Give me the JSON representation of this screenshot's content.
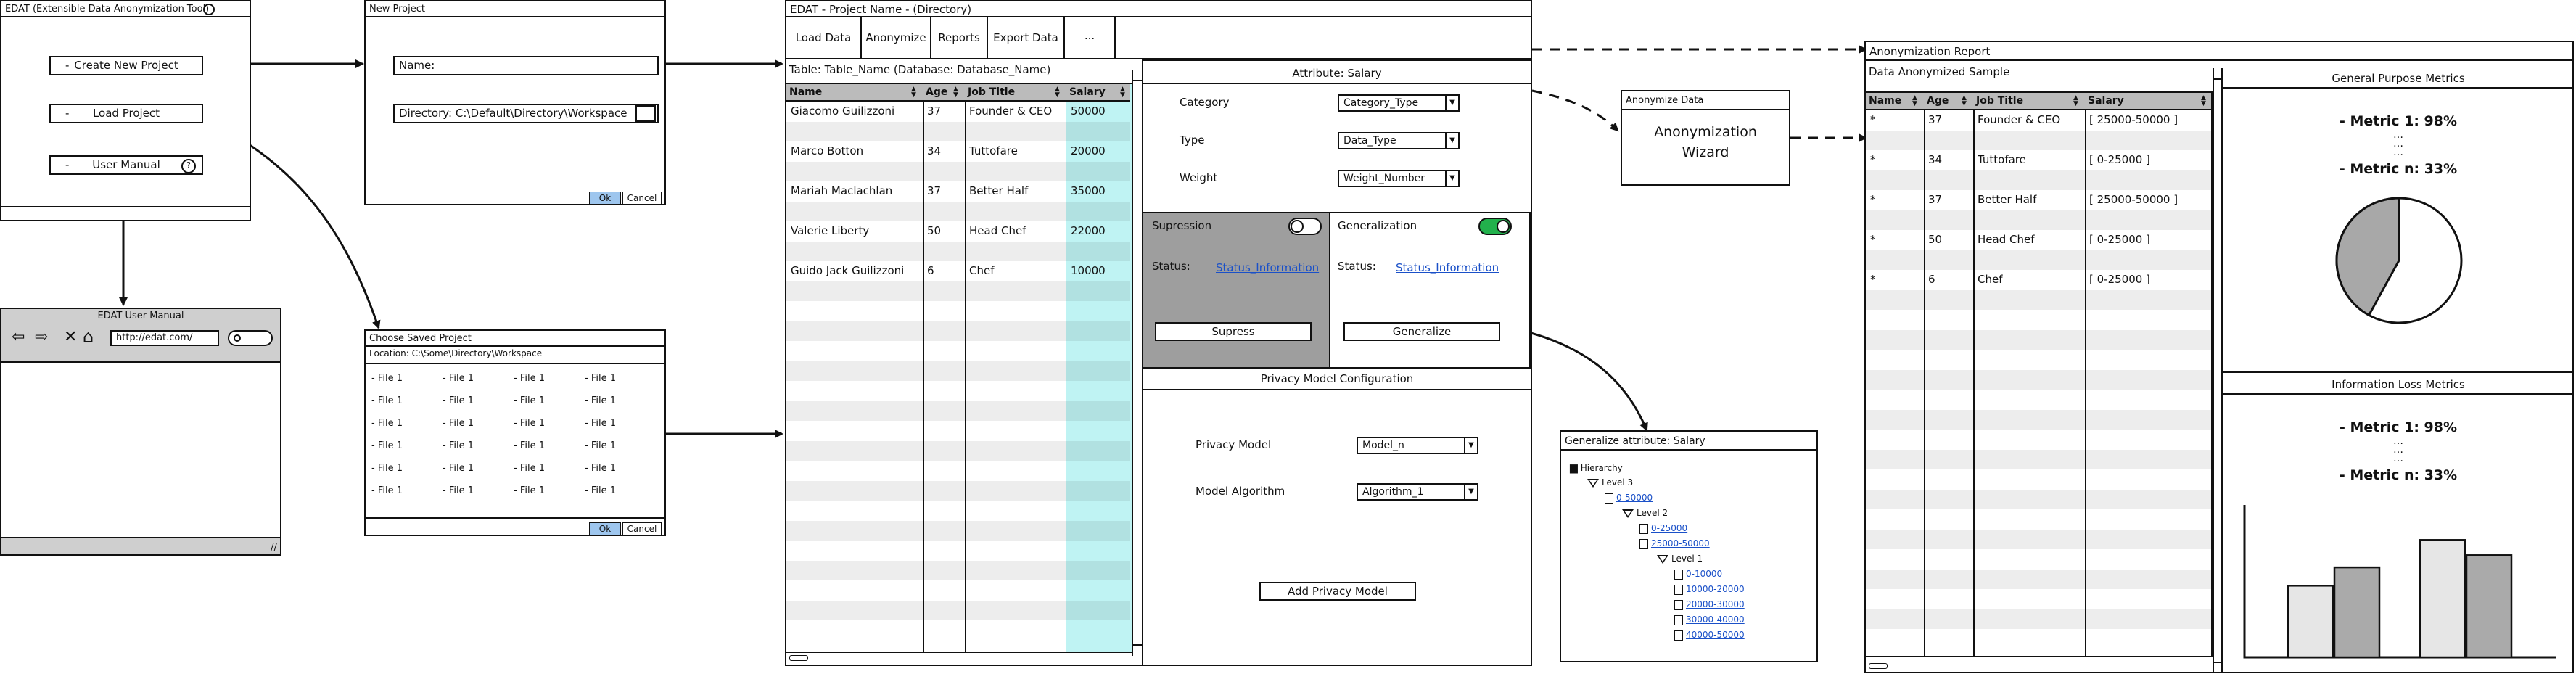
{
  "main_window": {
    "title": "EDAT (Extensible Data Anonymization Tool)",
    "buttons": [
      {
        "label": "Create New Project"
      },
      {
        "label": "Load Project"
      },
      {
        "label": "User Manual"
      }
    ]
  },
  "user_manual": {
    "title": "EDAT User Manual",
    "url": "http://edat.com/"
  },
  "new_project": {
    "title": "New Project",
    "name_label": "Name:",
    "directory_value": "Directory: C:\\Default\\Directory\\Workspace",
    "ok": "Ok",
    "cancel": "Cancel"
  },
  "choose_project": {
    "title": "Choose Saved Project",
    "location": "Location: C:\\Some\\Directory\\Workspace",
    "file_label": "- File 1",
    "rows": 6,
    "cols": 4,
    "ok": "Ok",
    "cancel": "Cancel"
  },
  "project_window": {
    "title": "EDAT - Project Name - (Directory)",
    "tabs": [
      "Load Data",
      "Anonymize",
      "Reports",
      "Export Data",
      "..."
    ],
    "table_caption": "Table: Table_Name (Database: Database_Name)",
    "columns": [
      "Name",
      "Age",
      "Job Title",
      "Salary"
    ],
    "rows": [
      [
        "Giacomo Guilizzoni",
        "37",
        "Founder & CEO",
        "50000"
      ],
      [
        "Marco Botton",
        "34",
        "Tuttofare",
        "20000"
      ],
      [
        "Mariah Maclachlan",
        "37",
        "Better Half",
        "35000"
      ],
      [
        "Valerie Liberty",
        "50",
        "Head Chef",
        "22000"
      ],
      [
        "Guido Jack Guilizzoni",
        "6",
        "Chef",
        "10000"
      ]
    ],
    "attribute": {
      "title": "Attribute: Salary",
      "fields": [
        {
          "label": "Category",
          "value": "Category_Type"
        },
        {
          "label": "Type",
          "value": "Data_Type"
        },
        {
          "label": "Weight",
          "value": "Weight_Number"
        }
      ]
    },
    "suppression": {
      "label": "Supression",
      "status_label": "Status:",
      "status_value": "Status_Information",
      "button": "Supress"
    },
    "generalization": {
      "label": "Generalization",
      "status_label": "Status:",
      "status_value": "Status_Information",
      "button": "Generalize"
    },
    "privacy": {
      "title": "Privacy Model Configuration",
      "model_label": "Privacy Model",
      "model_value": "Model_n",
      "algorithm_label": "Model Algorithm",
      "algorithm_value": "Algorithm_1",
      "button": "Add Privacy Model"
    }
  },
  "anonymize_data": {
    "title": "Anonymize Data",
    "body": "Anonymization Wizard"
  },
  "generalize_attr": {
    "title": "Generalize attribute: Salary",
    "tree": [
      {
        "label": "Hierarchy",
        "kind": "folder",
        "depth": 0
      },
      {
        "label": "Level 3",
        "kind": "level",
        "depth": 1
      },
      {
        "label": "0-50000",
        "kind": "file",
        "depth": 2
      },
      {
        "label": "Level 2",
        "kind": "level",
        "depth": 3
      },
      {
        "label": "0-25000",
        "kind": "file",
        "depth": 4
      },
      {
        "label": "25000-50000",
        "kind": "file",
        "depth": 4
      },
      {
        "label": "Level 1",
        "kind": "level",
        "depth": 5
      },
      {
        "label": "0-10000",
        "kind": "file",
        "depth": 6
      },
      {
        "label": "10000-20000",
        "kind": "file",
        "depth": 6
      },
      {
        "label": "20000-30000",
        "kind": "file",
        "depth": 6
      },
      {
        "label": "30000-40000",
        "kind": "file",
        "depth": 6
      },
      {
        "label": "40000-50000",
        "kind": "file",
        "depth": 6
      }
    ]
  },
  "report": {
    "title": "Anonymization Report",
    "sample_caption": "Data Anonymized Sample",
    "columns": [
      "Name",
      "Age",
      "Job Title",
      "Salary"
    ],
    "rows": [
      [
        "*",
        "37",
        "Founder & CEO",
        "[ 25000-50000 ]"
      ],
      [
        "*",
        "34",
        "Tuttofare",
        "[ 0-25000 ]"
      ],
      [
        "*",
        "37",
        "Better Half",
        "[ 25000-50000 ]"
      ],
      [
        "*",
        "50",
        "Head Chef",
        "[ 0-25000 ]"
      ],
      [
        "*",
        "6",
        "Chef",
        "[ 0-25000 ]"
      ]
    ],
    "general_metrics": {
      "title": "General Purpose Metrics",
      "metric_first": "- Metric 1: 98%",
      "metric_last": "- Metric n: 33%",
      "pie_fraction": 0.42
    },
    "loss_metrics": {
      "title": "Information Loss Metrics",
      "metric_first": "- Metric 1: 98%",
      "metric_last": "- Metric n: 33%",
      "bars": [
        0.47,
        0.59,
        0.77,
        0.67
      ]
    }
  },
  "colors": {
    "highlight": "#bff3f3",
    "header": "#bbbbbb",
    "panel_dark": "#9e9e9e",
    "toggle_on": "#22b14c",
    "ok": "#9ec6ee",
    "link": "#1a50c8"
  }
}
